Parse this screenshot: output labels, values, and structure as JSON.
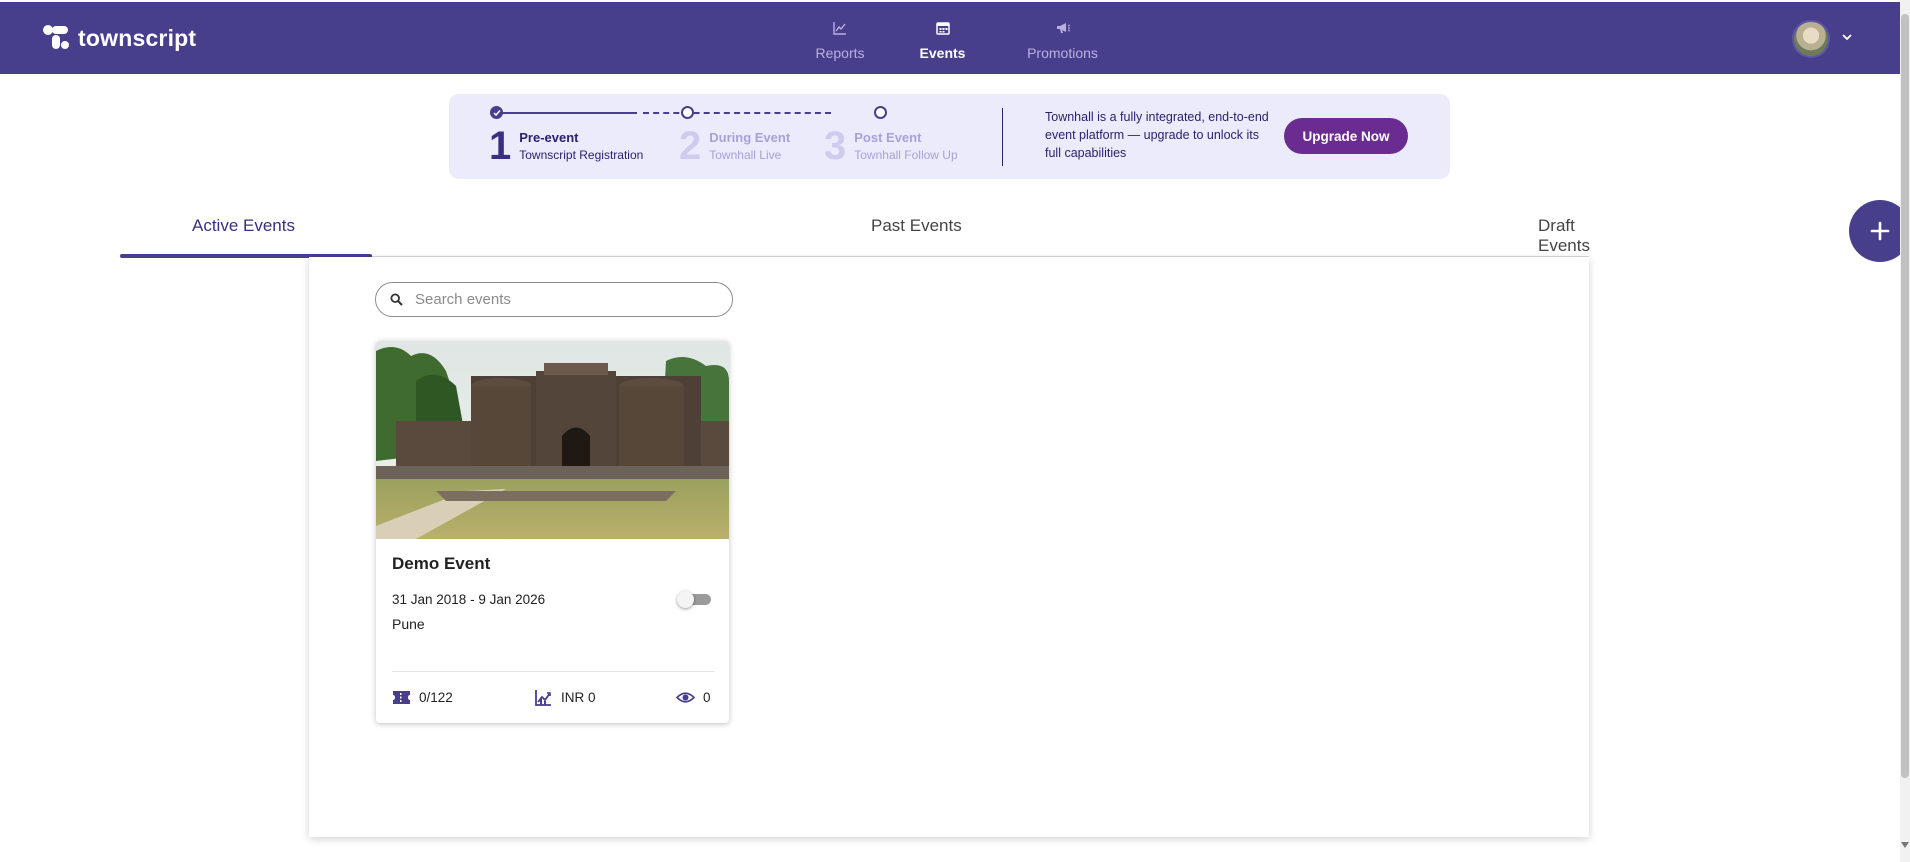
{
  "app": {
    "logo_text": "townscript"
  },
  "nav": {
    "items": [
      {
        "label": "Reports",
        "icon": "chart-line-icon"
      },
      {
        "label": "Events",
        "icon": "calendar-icon"
      },
      {
        "label": "Promotions",
        "icon": "megaphone-icon"
      }
    ],
    "active": "Events"
  },
  "banner": {
    "steps": [
      {
        "num": "1",
        "title": "Pre-event",
        "sub": "Townscript Registration"
      },
      {
        "num": "2",
        "title": "During Event",
        "sub": "Townhall Live"
      },
      {
        "num": "3",
        "title": "Post Event",
        "sub": "Townhall Follow Up"
      }
    ],
    "message": "Townhall is a fully integrated, end-to-end event platform — upgrade to unlock its full capabilities",
    "upgrade_label": "Upgrade Now"
  },
  "tabs": {
    "items": [
      {
        "label": "Active Events"
      },
      {
        "label": "Past Events"
      },
      {
        "label": "Draft Events"
      }
    ],
    "active": "Active Events"
  },
  "search": {
    "placeholder": "Search events",
    "value": ""
  },
  "events": [
    {
      "title": "Demo Event",
      "dates": "31 Jan 2018 - 9 Jan 2026",
      "city": "Pune",
      "published": false,
      "tickets": "0/122",
      "revenue": "INR 0",
      "views": "0"
    }
  ],
  "colors": {
    "brand": "#473f8c",
    "accent": "#6a2c91",
    "banner_bg": "#ecebfb"
  }
}
